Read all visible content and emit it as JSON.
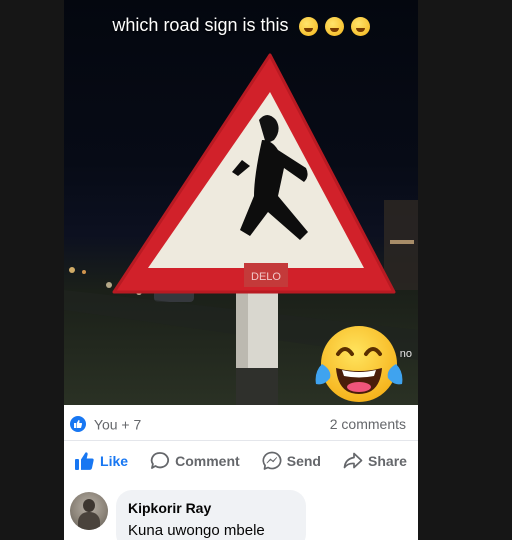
{
  "post": {
    "caption": "which road sign is this",
    "caption_emojis": [
      "shy-face-emoji",
      "rolling-laughing-emoji",
      "rolling-laughing-emoji"
    ],
    "overlay_text": "no"
  },
  "stats": {
    "reactions": "You + 7",
    "comments": "2 comments"
  },
  "actions": {
    "like": "Like",
    "comment": "Comment",
    "send": "Send",
    "share": "Share"
  },
  "comment": {
    "author": "Kipkorir Ray",
    "text": "Kuna uwongo mbele"
  },
  "colors": {
    "accent": "#1877f2",
    "sign_border": "#e0252a",
    "sign_fill": "#f2efe6",
    "background": "#161616"
  }
}
